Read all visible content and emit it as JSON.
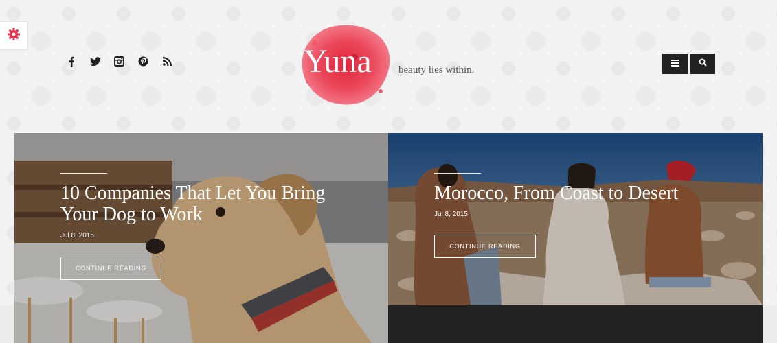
{
  "brand": {
    "logo_text": "Yuna",
    "tagline": "beauty lies within.",
    "accent": "#e8344d"
  },
  "header": {
    "social_icons": [
      "facebook-icon",
      "twitter-icon",
      "instagram-icon",
      "pinterest-icon",
      "rss-icon"
    ],
    "menu_icon": "menu-icon",
    "search_icon": "search-icon",
    "settings_icon": "gear-icon"
  },
  "posts": [
    {
      "title_line1": "10 Companies That Let You Bring",
      "title_line2": "Your Dog to Work",
      "date": "Jul 8, 2015",
      "button": "CONTINUE READING"
    },
    {
      "title_line1": "Morocco, From Coast to Desert",
      "date": "Jul 8, 2015",
      "button": "CONTINUE READING"
    }
  ]
}
